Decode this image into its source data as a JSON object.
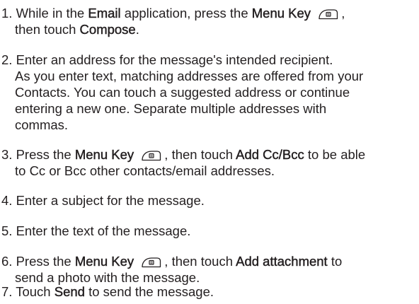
{
  "steps": [
    {
      "lines": [
        [
          {
            "t": "1. While in the "
          },
          {
            "t": "Email",
            "b": true
          },
          {
            "t": " application, press the "
          },
          {
            "t": "Menu Key",
            "b": true
          },
          {
            "t": " "
          },
          {
            "icon": "menu-key-icon"
          },
          {
            "t": ","
          }
        ],
        [
          {
            "t": "then touch "
          },
          {
            "t": "Compose",
            "b": true
          },
          {
            "t": "."
          }
        ]
      ]
    },
    {
      "lines": [
        [
          {
            "t": "2. Enter an address for the message's intended recipient."
          }
        ],
        [
          {
            "t": "As you enter text, matching addresses are offered from your"
          }
        ],
        [
          {
            "t": "Contacts. You can touch a suggested address or continue"
          }
        ],
        [
          {
            "t": "entering a new one. Separate multiple addresses with"
          }
        ],
        [
          {
            "t": "commas."
          }
        ]
      ]
    },
    {
      "lines": [
        [
          {
            "t": "3. Press the "
          },
          {
            "t": "Menu Key",
            "b": true
          },
          {
            "t": " "
          },
          {
            "icon": "menu-key-icon"
          },
          {
            "t": ", then touch "
          },
          {
            "t": "Add Cc/Bcc",
            "b": true
          },
          {
            "t": " to be able"
          }
        ],
        [
          {
            "t": "to Cc or Bcc other contacts/email addresses."
          }
        ]
      ]
    },
    {
      "lines": [
        [
          {
            "t": "4. Enter a subject for the message."
          }
        ]
      ]
    },
    {
      "lines": [
        [
          {
            "t": "5. Enter the text of the message."
          }
        ]
      ]
    },
    {
      "lines": [
        [
          {
            "t": "6. Press the "
          },
          {
            "t": "Menu Key",
            "b": true
          },
          {
            "t": " "
          },
          {
            "icon": "menu-key-icon"
          },
          {
            "t": ", then touch "
          },
          {
            "t": "Add attachment",
            "b": true
          },
          {
            "t": " to"
          }
        ],
        [
          {
            "t": "send a photo with the message."
          }
        ]
      ]
    },
    {
      "lines": [
        [
          {
            "t": "7. Touch "
          },
          {
            "t": "Send",
            "b": true
          },
          {
            "t": " to send the message."
          }
        ]
      ]
    }
  ],
  "colors": {
    "text": "#231f20",
    "background": "#ffffff"
  }
}
